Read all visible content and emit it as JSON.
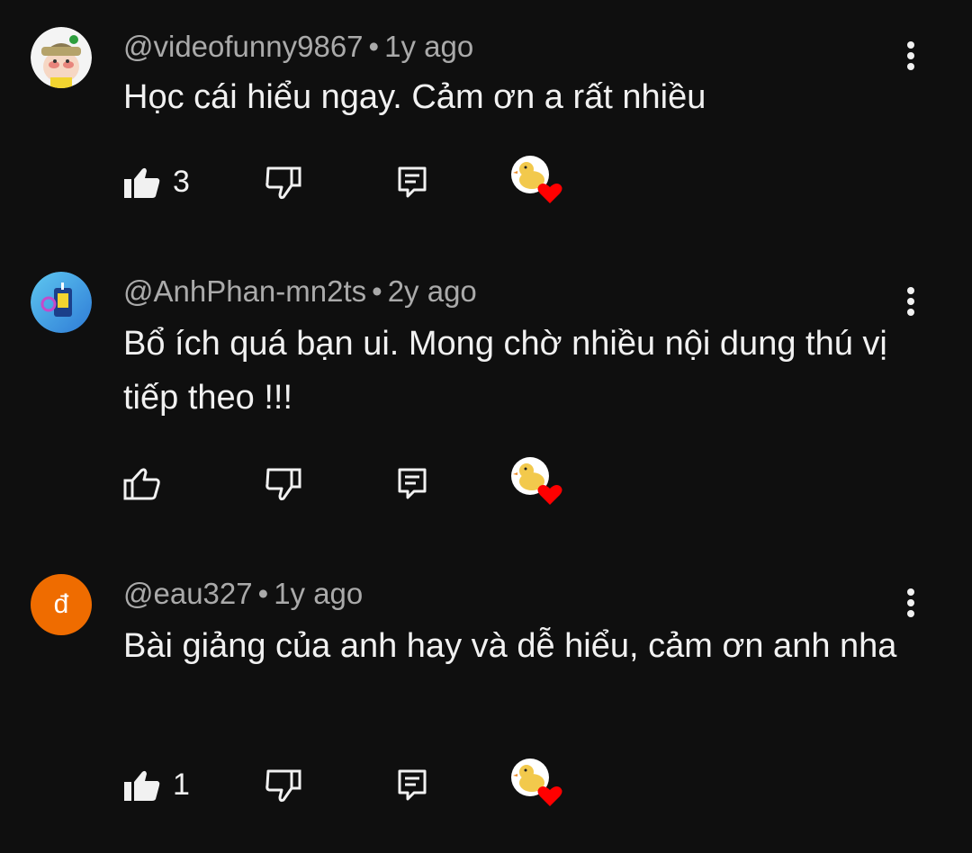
{
  "comments": [
    {
      "author": "@videofunny9867",
      "separator": "•",
      "time": "1y ago",
      "text": "Học cái hiểu ngay. Cảm ơn a rất nhiều",
      "likes": "3",
      "liked": true,
      "avatar": "cartoon-character-avatar"
    },
    {
      "author": "@AnhPhan-mn2ts",
      "separator": "•",
      "time": "2y ago",
      "text": "Bổ ích quá bạn ui. Mong chờ nhiều nội dung thú vị tiếp theo !!!",
      "likes": "",
      "liked": false,
      "avatar": "blue-music-avatar"
    },
    {
      "author": "@eau327",
      "separator": "•",
      "time": "1y ago",
      "text": "Bài giảng của anh hay và dễ hiểu, cảm ơn anh nha",
      "likes": "1",
      "liked": true,
      "avatar_letter": "đ",
      "avatar_color": "#ef6c00"
    }
  ],
  "colors": {
    "background": "#0f0f0f",
    "text": "#f1f1f1",
    "meta": "#aaaaaa",
    "heart": "#ff0000"
  }
}
